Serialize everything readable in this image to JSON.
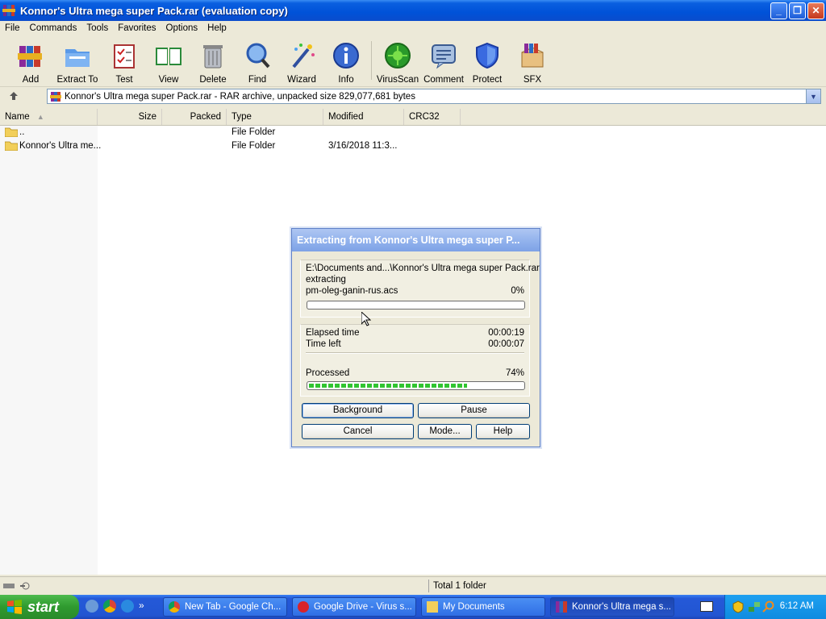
{
  "window": {
    "title": "Konnor's Ultra mega super Pack.rar (evaluation copy)",
    "controls": {
      "minimize": "_",
      "maximize": "❐",
      "close": "✕"
    }
  },
  "menu": [
    "File",
    "Commands",
    "Tools",
    "Favorites",
    "Options",
    "Help"
  ],
  "toolbar": [
    {
      "label": "Add",
      "icon": "add-archive-icon"
    },
    {
      "label": "Extract To",
      "icon": "extract-folder-icon"
    },
    {
      "label": "Test",
      "icon": "test-clipboard-icon"
    },
    {
      "label": "View",
      "icon": "book-view-icon"
    },
    {
      "label": "Delete",
      "icon": "trash-can-icon"
    },
    {
      "label": "Find",
      "icon": "magnifier-icon"
    },
    {
      "label": "Wizard",
      "icon": "magic-wand-icon"
    },
    {
      "label": "Info",
      "icon": "info-icon"
    },
    {
      "label": "VirusScan",
      "icon": "virus-scan-icon"
    },
    {
      "label": "Comment",
      "icon": "comment-icon"
    },
    {
      "label": "Protect",
      "icon": "shield-icon"
    },
    {
      "label": "SFX",
      "icon": "sfx-box-icon"
    }
  ],
  "address": {
    "text": "Konnor's Ultra mega super Pack.rar - RAR archive, unpacked size 829,077,681 bytes"
  },
  "columns": [
    "Name",
    "Size",
    "Packed",
    "Type",
    "Modified",
    "CRC32"
  ],
  "files": [
    {
      "name": "..",
      "size": "",
      "packed": "",
      "type": "File Folder",
      "modified": ""
    },
    {
      "name": "Konnor's Ultra me...",
      "size": "",
      "packed": "",
      "type": "File Folder",
      "modified": "3/16/2018 11:3..."
    }
  ],
  "status": {
    "text": "Total 1 folder"
  },
  "dialog": {
    "title": "Extracting from Konnor's Ultra mega super P...",
    "path": "E:\\Documents and...\\Konnor's Ultra mega super Pack.rar",
    "action": "extracting",
    "current_file": "pm-oleg-ganin-rus.acs",
    "file_percent": "0%",
    "file_progress": 0,
    "elapsed_label": "Elapsed time",
    "elapsed_value": "00:00:19",
    "left_label": "Time left",
    "left_value": "00:00:07",
    "processed_label": "Processed",
    "processed_percent": "74%",
    "processed_progress": 0.74,
    "buttons": {
      "background": "Background",
      "pause": "Pause",
      "cancel": "Cancel",
      "mode": "Mode...",
      "help": "Help"
    }
  },
  "taskbar": {
    "start": "start",
    "tasks": [
      {
        "label": "New Tab - Google Ch...",
        "icon": "chrome-icon"
      },
      {
        "label": "Google Drive - Virus s...",
        "icon": "opera-icon"
      },
      {
        "label": "My Documents",
        "icon": "folder-icon"
      },
      {
        "label": "Konnor's Ultra mega s...",
        "icon": "winrar-icon"
      }
    ],
    "clock": "6:12 AM"
  },
  "colors": {
    "titlebar": "#0052d8",
    "taskbar": "#2459d8",
    "start": "#2f9a2f",
    "progress": "#31c431"
  }
}
